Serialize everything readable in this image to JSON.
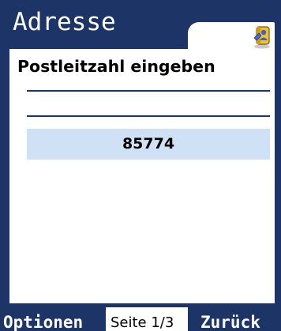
{
  "header": {
    "title": "Adresse",
    "icon": "address-book-icon"
  },
  "main": {
    "heading": "Postleitzahl eingeben",
    "input_value": "85774"
  },
  "softkeys": {
    "left_label": "Optionen",
    "page_indicator": "Seite 1/3",
    "right_label": "Zurück"
  },
  "colors": {
    "frame": "#1c3466",
    "panel": "#ffffff",
    "highlight": "#cfe1f5"
  }
}
